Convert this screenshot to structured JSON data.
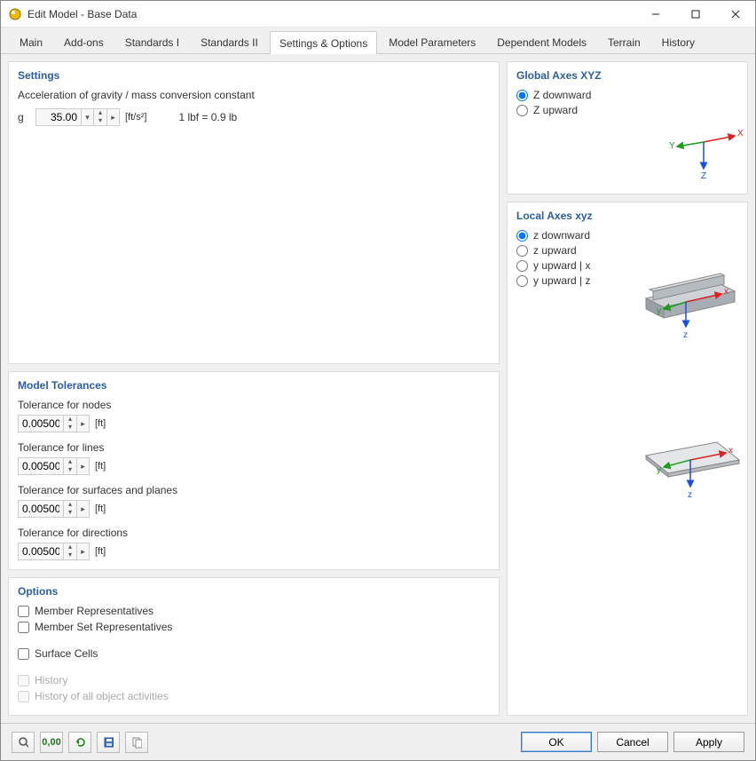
{
  "window": {
    "title": "Edit Model - Base Data"
  },
  "tabs": [
    {
      "label": "Main"
    },
    {
      "label": "Add-ons"
    },
    {
      "label": "Standards I"
    },
    {
      "label": "Standards II"
    },
    {
      "label": "Settings & Options"
    },
    {
      "label": "Model Parameters"
    },
    {
      "label": "Dependent Models"
    },
    {
      "label": "Terrain"
    },
    {
      "label": "History"
    }
  ],
  "active_tab": 4,
  "settings": {
    "title": "Settings",
    "accel_label": "Acceleration of gravity / mass conversion constant",
    "g_label": "g",
    "g_value": "35.00",
    "g_unit": "[ft/s²]",
    "lbf_note": "1 lbf = 0.9 lb"
  },
  "tolerances": {
    "title": "Model Tolerances",
    "items": [
      {
        "label": "Tolerance for nodes",
        "value": "0.00500",
        "unit": "[ft]"
      },
      {
        "label": "Tolerance for lines",
        "value": "0.00500",
        "unit": "[ft]"
      },
      {
        "label": "Tolerance for surfaces and planes",
        "value": "0.00500",
        "unit": "[ft]"
      },
      {
        "label": "Tolerance for directions",
        "value": "0.00500",
        "unit": "[ft]"
      }
    ]
  },
  "options": {
    "title": "Options",
    "member_rep": "Member Representatives",
    "member_set_rep": "Member Set Representatives",
    "surface_cells": "Surface Cells",
    "history": "History",
    "history_all": "History of all object activities"
  },
  "global_axes": {
    "title": "Global Axes XYZ",
    "z_down": "Z downward",
    "z_up": "Z upward",
    "labels": {
      "x": "X",
      "y": "Y",
      "z": "Z"
    }
  },
  "local_axes": {
    "title": "Local Axes xyz",
    "opts": [
      "z downward",
      "z upward",
      "y upward | x",
      "y upward | z"
    ],
    "labels": {
      "x": "x",
      "y": "y",
      "z": "z"
    }
  },
  "footer": {
    "ok": "OK",
    "cancel": "Cancel",
    "apply": "Apply"
  }
}
